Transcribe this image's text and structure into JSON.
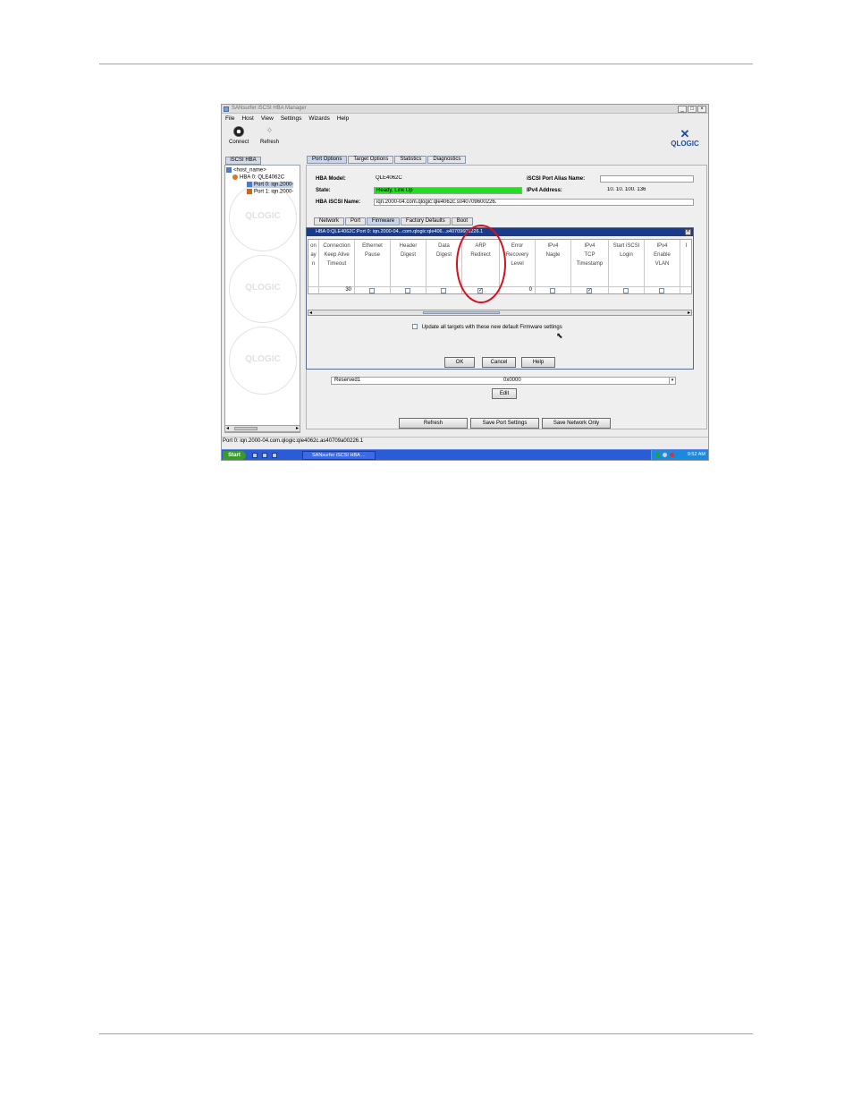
{
  "app": {
    "window_title": "SANsurfer iSCSI HBA Manager",
    "window_buttons": [
      "_",
      "□",
      "×"
    ],
    "menu": [
      "File",
      "Host",
      "View",
      "Settings",
      "Wizards",
      "Help"
    ],
    "toolbar": {
      "connect_label": "Connect",
      "refresh_label": "Refresh"
    },
    "logo_text": "QLOGIC"
  },
  "left_panel": {
    "tab_label": "iSCSI HBA",
    "tree": [
      {
        "label": "<host_name>",
        "level": 0
      },
      {
        "label": "HBA 0: QLE4062C",
        "level": 1
      },
      {
        "label": "Port 0: iqn.2000-",
        "level": 2
      },
      {
        "label": "Port 1: iqn.2000-",
        "level": 2
      }
    ],
    "watermark_text": "QLOGIC"
  },
  "main_tabs": [
    "Port Options",
    "Target Options",
    "Statistics",
    "Diagnostics"
  ],
  "hba_info": {
    "model_label": "HBA Model:",
    "model_value": "QLE4062C",
    "state_label": "State:",
    "state_value": "Ready, Link Up",
    "state_color": "#22e01e",
    "iscsi_name_label": "HBA iSCSI Name:",
    "iscsi_name_value": "iqn.2000-04.com.qlogic:qle4062c.s040709600226.",
    "alias_label": "iSCSI Port Alias Name:",
    "alias_value": "",
    "ipv4_label": "IPv4 Address:",
    "ipv4_value": "10.   10.   100.   136"
  },
  "sub_tabs": [
    "Network",
    "Port",
    "Firmware",
    "Factory Defaults",
    "Boot"
  ],
  "dialog": {
    "title": "HBA 0:QLE4062C:Port 0: iqn.2000-04...com.qlogic:qle406...s40709600226.1",
    "close": "×",
    "columns": [
      {
        "header": [
          "on",
          "ay",
          "n"
        ],
        "type": "text",
        "value": ""
      },
      {
        "header": [
          "Connection",
          "Keep Alive",
          "Timeout"
        ],
        "type": "number",
        "value": "30"
      },
      {
        "header": [
          "Ethernet",
          "Pause"
        ],
        "type": "checkbox",
        "checked": false
      },
      {
        "header": [
          "Header",
          "Digest"
        ],
        "type": "checkbox",
        "checked": false
      },
      {
        "header": [
          "Data",
          "Digest"
        ],
        "type": "checkbox",
        "checked": false
      },
      {
        "header": [
          "ARP",
          "Redirect"
        ],
        "type": "checkbox",
        "checked": true
      },
      {
        "header": [
          "Error",
          "Recovery",
          "Level"
        ],
        "type": "number",
        "value": "0"
      },
      {
        "header": [
          "IPv4",
          "Nagle"
        ],
        "type": "checkbox",
        "checked": false
      },
      {
        "header": [
          "IPv4",
          "TCP",
          "Timestamp"
        ],
        "type": "checkbox",
        "checked": true
      },
      {
        "header": [
          "Start iSCSI",
          "Login"
        ],
        "type": "checkbox",
        "checked": false
      },
      {
        "header": [
          "IPv4",
          "Enable",
          "VLAN"
        ],
        "type": "checkbox",
        "checked": false
      },
      {
        "header": [
          "I"
        ],
        "type": "text",
        "value": ""
      }
    ],
    "checkmark": "✓",
    "update_targets_label": "Update all targets with these new default Firmware settings",
    "update_targets_checked": false,
    "buttons": {
      "ok": "OK",
      "cancel": "Cancel",
      "help": "Help"
    }
  },
  "reserved_row": {
    "label": "Reserved1",
    "value": "0x0000"
  },
  "edit_button": "Edit",
  "bottom_buttons": {
    "refresh": "Refresh",
    "save_port": "Save Port Settings",
    "save_network": "Save Network Only"
  },
  "status_bar": "Port 0: iqn.2000-04.com.qlogic:qle4062c.as40709a00226.1",
  "taskbar": {
    "start": "Start",
    "task": "SANsurfer iSCSI HBA ...",
    "clock": "9:52 AM"
  },
  "colors": {
    "annotation": "#d4101c",
    "title_bar": "#1a3a8a",
    "taskbar": "#2c5bd6"
  }
}
